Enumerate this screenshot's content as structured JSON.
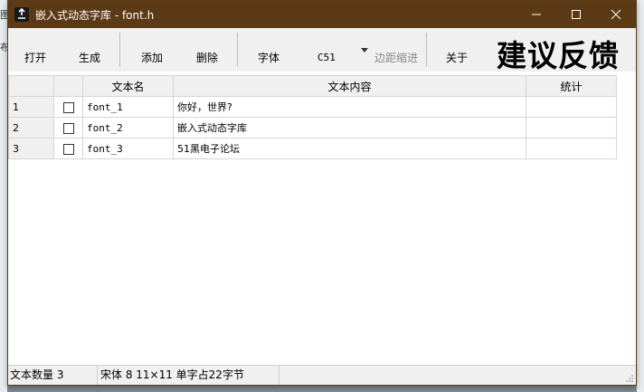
{
  "window": {
    "title": "嵌入式动态字库 - font.h"
  },
  "background": {
    "left_fragments": [
      "图",
      "布"
    ]
  },
  "toolbar": {
    "open": "打开",
    "generate": "生成",
    "add": "添加",
    "delete": "删除",
    "font": "字体",
    "font_select_value": "C51",
    "indent": "边距缩进",
    "about": "关于",
    "feedback": "建议反馈"
  },
  "table": {
    "headers": [
      "",
      "",
      "文本名",
      "文本内容",
      "统计"
    ],
    "rows": [
      {
        "index": "1",
        "name": "font_1",
        "content": "你好，世界?",
        "count": ""
      },
      {
        "index": "2",
        "name": "font_2",
        "content": "嵌入式动态字库",
        "count": ""
      },
      {
        "index": "3",
        "name": "font_3",
        "content": "51黑电子论坛",
        "count": ""
      }
    ]
  },
  "status": {
    "text_count": "文本数量 3",
    "font_info": "宋体 8 11×11 单字占22字节"
  },
  "colors": {
    "titlebar": "#5c3a16",
    "toolbar": "#f0f0f0"
  }
}
